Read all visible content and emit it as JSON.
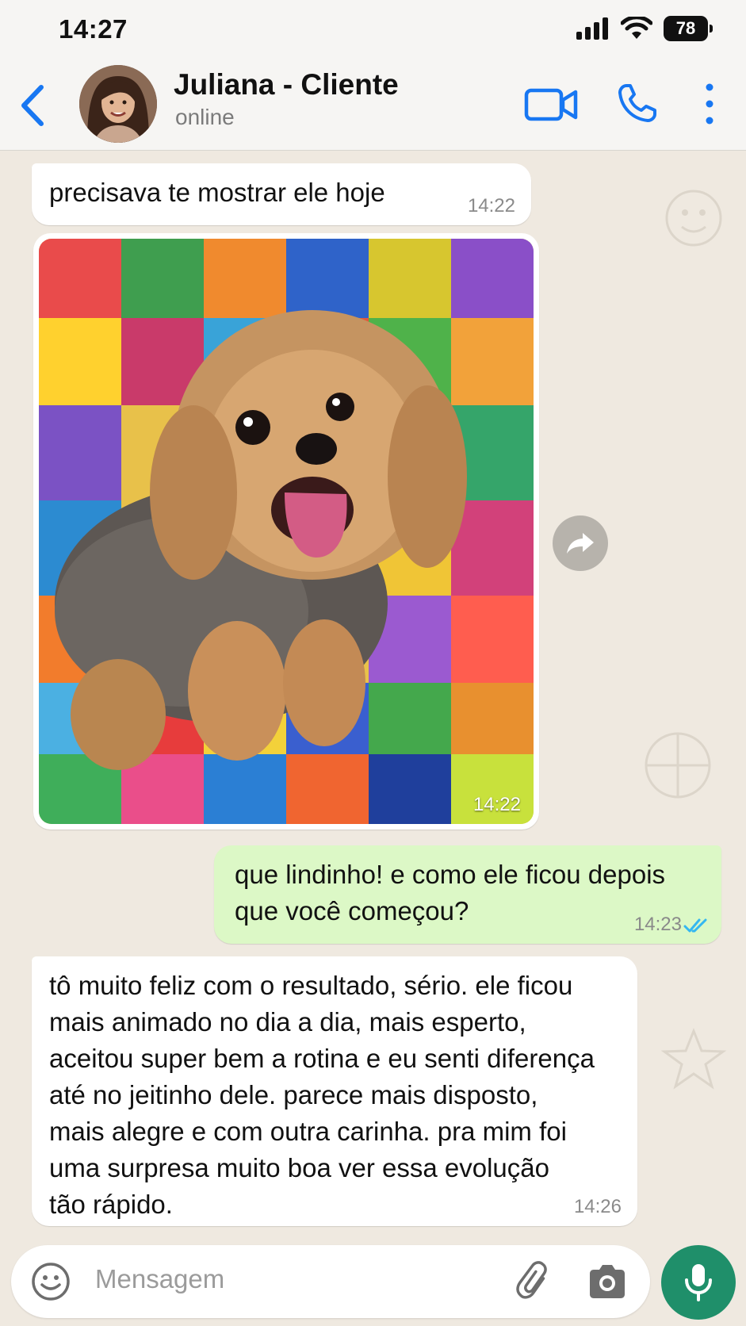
{
  "status_bar": {
    "time": "14:27",
    "battery": "78"
  },
  "header": {
    "contact_name": "Juliana - Cliente",
    "contact_status": "online",
    "accent_color": "#1877f2"
  },
  "messages": [
    {
      "direction": "incoming",
      "type": "text",
      "text": "precisava te mostrar ele hoje",
      "time": "14:22"
    },
    {
      "direction": "incoming",
      "type": "image",
      "image_subject": "yorkshire terrier dog on colorful patchwork quilt",
      "time": "14:22"
    },
    {
      "direction": "outgoing",
      "type": "text",
      "lines": [
        "que lindinho! e como ele ficou depois",
        "que você começou?"
      ],
      "time": "14:23",
      "status": "read"
    },
    {
      "direction": "incoming",
      "type": "text",
      "lines": [
        "tô muito feliz com o resultado, sério. ele ficou",
        "mais animado no dia a dia, mais esperto,",
        "aceitou super bem a rotina e eu senti diferença",
        "até no jeitinho dele. parece mais disposto,",
        "mais alegre e com outra carinha. pra mim foi",
        "uma surpresa muito boa ver essa evolução",
        "tão rápido."
      ],
      "time": "14:26"
    }
  ],
  "composer": {
    "placeholder": "Mensagem",
    "mic_color": "#1f8f6a"
  },
  "colors": {
    "outgoing_bubble": "#dcf8c6",
    "incoming_bubble": "#ffffff",
    "chat_background": "#efe9e0",
    "read_ticks": "#34b7f1"
  }
}
